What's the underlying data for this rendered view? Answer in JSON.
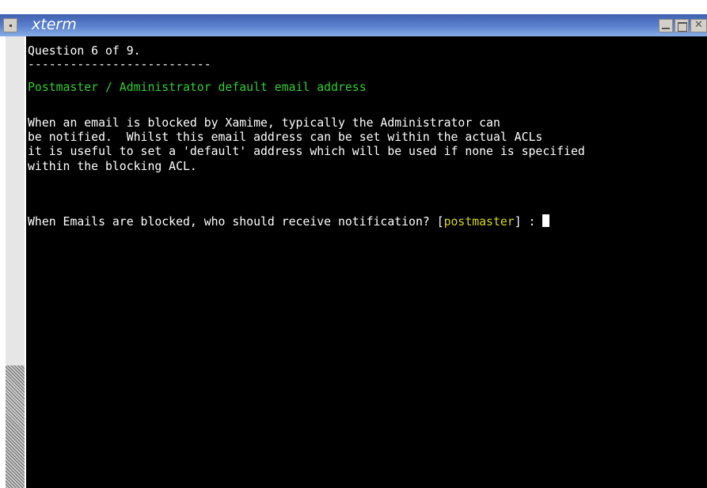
{
  "window": {
    "title": "xterm"
  },
  "terminal": {
    "question_line": "Question 6 of 9.",
    "separator": "--------------------------",
    "heading": "Postmaster / Administrator default email address",
    "paragraph": [
      "When an email is blocked by Xamime, typically the Administrator can",
      "be notified.  Whilst this email address can be set within the actual ACLs",
      "it is useful to set a 'default' address which will be used if none is specified",
      "within the blocking ACL."
    ],
    "prompt_prefix": "When Emails are blocked, who should receive notification? [",
    "prompt_default": "postmaster",
    "prompt_suffix": "] : "
  },
  "colors": {
    "heading": "#33cc33",
    "default_value": "#d8d820",
    "background": "#000000",
    "title_bar": "#5c82cf"
  }
}
